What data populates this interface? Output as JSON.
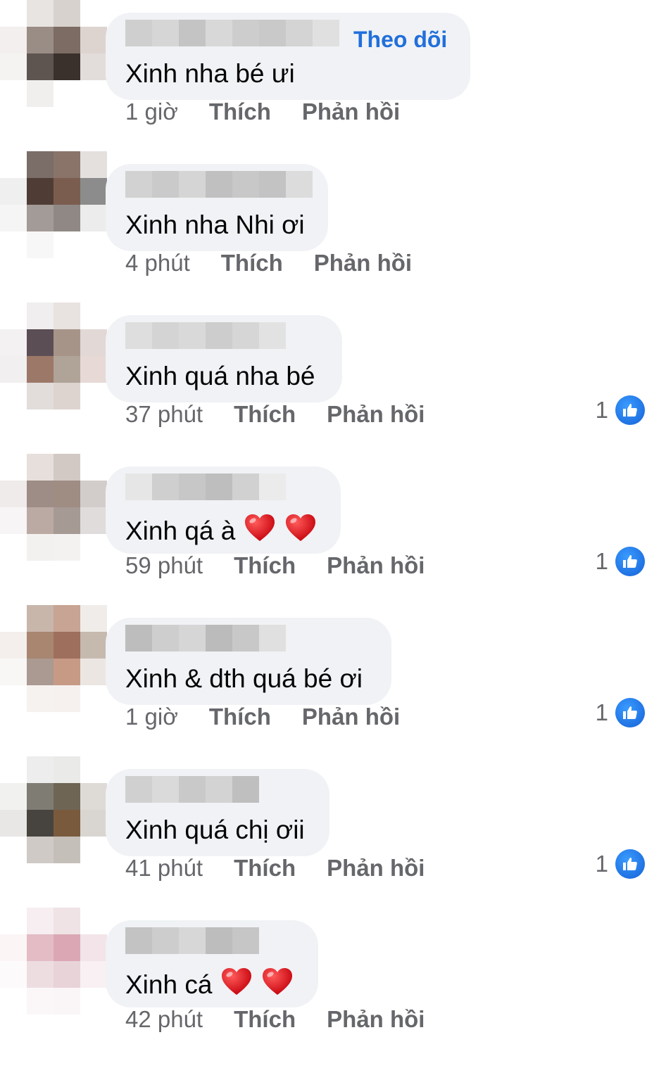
{
  "comments": [
    {
      "follow_label": "Theo dõi",
      "text": "Xinh nha bé ưi",
      "time": "1 giờ",
      "like_label": "Thích",
      "reply_label": "Phản hồi",
      "reaction_count": null,
      "hearts": 0,
      "avatar_colors": [
        "#ffffff",
        "#e8e4e2",
        "#d8d2cf",
        "#ffffff",
        "#f3efee",
        "#9a8d86",
        "#7c6c64",
        "#ddd4d0",
        "#f5f3f2",
        "#5f5550",
        "#3a302c",
        "#e2ddda",
        "#ffffff",
        "#f1efee",
        "#ffffff",
        "#ffffff"
      ],
      "name_colors": [
        "#cfcfcf",
        "#d6d6d6",
        "#c4c4c4",
        "#d8d8d8",
        "#cdcdcd",
        "#c9c9c9",
        "#d4d4d4",
        "#e0e0e0"
      ]
    },
    {
      "text": "Xinh nha Nhi ơi",
      "time": "4 phút",
      "like_label": "Thích",
      "reply_label": "Phản hồi",
      "reaction_count": null,
      "hearts": 0,
      "avatar_colors": [
        "#ffffff",
        "#7b6d67",
        "#8a746a",
        "#e4e0de",
        "#efefef",
        "#4f3d35",
        "#7b5d50",
        "#8c8c8c",
        "#f5f5f5",
        "#a39b97",
        "#8f8884",
        "#ececec",
        "#ffffff",
        "#f7f7f7",
        "#ffffff",
        "#ffffff"
      ],
      "name_colors": [
        "#d2d2d2",
        "#cacaca",
        "#d5d5d5",
        "#c0c0c0",
        "#c8c8c8",
        "#c3c3c3",
        "#dcdcdc"
      ]
    },
    {
      "text": "Xinh quá nha bé",
      "time": "37 phút",
      "like_label": "Thích",
      "reply_label": "Phản hồi",
      "reaction_count": "1",
      "hearts": 0,
      "avatar_colors": [
        "#ffffff",
        "#f0eeee",
        "#e8e2e0",
        "#ffffff",
        "#f3f1f1",
        "#5b4e55",
        "#a79488",
        "#e2d8d6",
        "#f1efef",
        "#9c7868",
        "#b0a398",
        "#e6d9d6",
        "#ffffff",
        "#e2dcda",
        "#ddd3cf",
        "#ffffff"
      ],
      "name_colors": [
        "#dedede",
        "#d4d4d4",
        "#d9d9d9",
        "#cdcdcd",
        "#d6d6d6",
        "#e2e2e2"
      ]
    },
    {
      "text": "Xinh qá à",
      "time": "59 phút",
      "like_label": "Thích",
      "reply_label": "Phản hồi",
      "reaction_count": "1",
      "hearts": 2,
      "avatar_colors": [
        "#ffffff",
        "#e7dfdb",
        "#d2c9c5",
        "#ffffff",
        "#efebea",
        "#9d8d86",
        "#9f8c82",
        "#d2cdcb",
        "#f7f5f5",
        "#bbaaa3",
        "#a59a94",
        "#e0dcdb",
        "#ffffff",
        "#f3f1f0",
        "#f4f2f1",
        "#ffffff"
      ],
      "name_colors": [
        "#e6e6e6",
        "#cfcfcf",
        "#c7c7c7",
        "#bebebe",
        "#d1d1d1",
        "#ebebeb"
      ]
    },
    {
      "text": "Xinh & dth quá bé ơi",
      "time": "1 giờ",
      "like_label": "Thích",
      "reply_label": "Phản hồi",
      "reaction_count": "1",
      "hearts": 0,
      "avatar_colors": [
        "#ffffff",
        "#c9b6ab",
        "#c7a493",
        "#f0ece9",
        "#f4efec",
        "#a88670",
        "#9e6f5c",
        "#c6b9ae",
        "#f9f7f6",
        "#aa9a92",
        "#c79a85",
        "#ece6e3",
        "#ffffff",
        "#f6f2f0",
        "#f6f1ef",
        "#ffffff"
      ],
      "name_colors": [
        "#bdbdbd",
        "#cecece",
        "#d6d6d6",
        "#bbbbbb",
        "#c8c8c8",
        "#e0e0e0"
      ]
    },
    {
      "text": "Xinh quá chị ơii",
      "time": "41 phút",
      "like_label": "Thích",
      "reply_label": "Phản hồi",
      "reaction_count": "1",
      "hearts": 0,
      "avatar_colors": [
        "#ffffff",
        "#ededed",
        "#eaeae9",
        "#ffffff",
        "#f1f1f0",
        "#7f7c74",
        "#6e6555",
        "#dedad6",
        "#e8e7e6",
        "#474440",
        "#7a5a3d",
        "#d9d5d1",
        "#ffffff",
        "#cfcac6",
        "#c5bfba",
        "#ffffff"
      ],
      "name_colors": [
        "#d0d0d0",
        "#dadada",
        "#c9c9c9",
        "#d3d3d3",
        "#bfbfbf"
      ]
    },
    {
      "text": "Xinh cá",
      "time": "42 phút",
      "like_label": "Thích",
      "reply_label": "Phản hồi",
      "reaction_count": null,
      "hearts": 2,
      "avatar_colors": [
        "#ffffff",
        "#f6eef0",
        "#efe3e6",
        "#ffffff",
        "#fbf5f6",
        "#e3bcc6",
        "#dba7b4",
        "#f2e4e8",
        "#fdfafb",
        "#eddde1",
        "#e8d3d9",
        "#f8f0f2",
        "#ffffff",
        "#fbf7f8",
        "#faf6f7",
        "#ffffff"
      ],
      "name_colors": [
        "#c3c3c3",
        "#cdcdcd",
        "#d7d7d7",
        "#bdbdbd",
        "#c6c6c6"
      ]
    }
  ]
}
